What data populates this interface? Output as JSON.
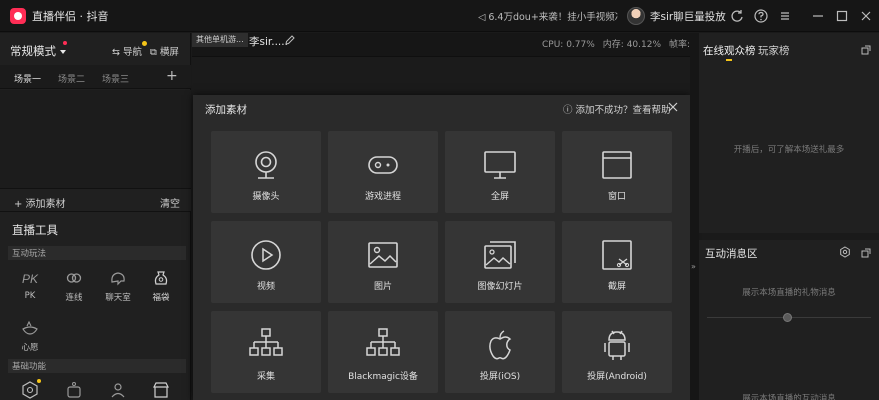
{
  "titlebar": {
    "app_title": "直播伴侣 · 抖音",
    "ticker": "6.4万dou+来袭！挂小手视频冲...",
    "user_name": "李sir聊巨量投放"
  },
  "left": {
    "scene_mode": "常规模式",
    "guide": "导航",
    "landscape": "横屏",
    "scene_tabs": [
      "场景一",
      "场景二",
      "场景三"
    ],
    "add_source": "+ 添加素材",
    "clear": "清空",
    "live_tools_title": "直播工具",
    "section_interactive": "互动玩法",
    "section_basic": "基础功能",
    "tools": [
      {
        "label": "PK"
      },
      {
        "label": "连线"
      },
      {
        "label": "聊天室"
      },
      {
        "label": "福袋"
      },
      {
        "label": "心愿"
      }
    ]
  },
  "center": {
    "room_tag": "其他单机游...",
    "room_title": "李sir.....",
    "cpu": "CPU: 0.77%",
    "memory": "内存: 40.12%",
    "fps": "帧率:30"
  },
  "modal": {
    "title": "添加素材",
    "help": "添加不成功？查看帮助",
    "tiles": [
      {
        "label": "摄像头",
        "icon": "camera-icon"
      },
      {
        "label": "游戏进程",
        "icon": "gamepad-icon"
      },
      {
        "label": "全屏",
        "icon": "monitor-icon"
      },
      {
        "label": "窗口",
        "icon": "window-icon"
      },
      {
        "label": "视频",
        "icon": "play-icon"
      },
      {
        "label": "图片",
        "icon": "image-icon"
      },
      {
        "label": "图像幻灯片",
        "icon": "slideshow-icon"
      },
      {
        "label": "截屏",
        "icon": "screenshot-icon"
      },
      {
        "label": "采集",
        "icon": "capture-icon"
      },
      {
        "label": "Blackmagic设备",
        "icon": "blackmagic-icon"
      },
      {
        "label": "投屏(iOS)",
        "icon": "apple-icon"
      },
      {
        "label": "投屏(Android)",
        "icon": "android-icon"
      }
    ]
  },
  "right": {
    "tab_viewers": "在线观众榜",
    "tab_players": "玩家榜",
    "viewers_empty": "开播后，可了解本场送礼最多",
    "messages_title": "互动消息区",
    "messages_empty": "展示本场直播的礼物消息",
    "messages_empty_2": "展示本场直播的互动消息"
  },
  "colors": {
    "accent": "#f5c518",
    "brand": "#ff2d55",
    "background": "#1a1a1a",
    "tile": "#353535"
  }
}
